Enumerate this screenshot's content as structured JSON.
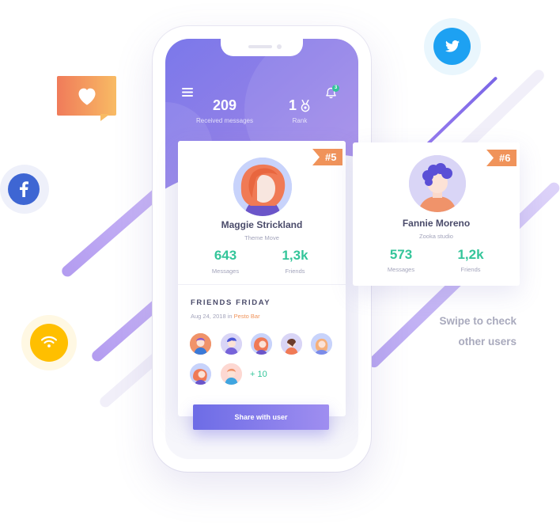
{
  "header": {
    "menu_icon": "hamburger-icon",
    "notification_icon": "bell-icon",
    "notification_count": "3",
    "received_messages_value": "209",
    "received_messages_label": "Received messages",
    "rank_value": "1",
    "rank_label": "Rank",
    "rank_icon": "medal-icon"
  },
  "main_card": {
    "badge": "#5",
    "name": "Maggie Strickland",
    "subtitle": "Theme Move",
    "messages_value": "643",
    "messages_label": "Messages",
    "friends_value": "1,3k",
    "friends_label": "Friends"
  },
  "friends_friday": {
    "title": "FRIENDS FRIDAY",
    "date": "Aug 24, 2018 in ",
    "venue": "Pesto Bar",
    "more_count": "+ 10",
    "share_button": "Share with user"
  },
  "next_card": {
    "badge": "#6",
    "name": "Fannie Moreno",
    "subtitle": "Zooka studio",
    "messages_value": "573",
    "messages_label": "Messages",
    "friends_value": "1,2k",
    "friends_label": "Friends"
  },
  "hint": {
    "line1": "Swipe to check",
    "line2": "other users"
  },
  "social_icons": [
    "heart-icon",
    "facebook-icon",
    "twitter-icon",
    "wifi-icon"
  ],
  "colors": {
    "accent_purple": "#7b78ea",
    "badge_orange": "#f0935a",
    "metric_green": "#34c59a",
    "facebook_blue": "#3e66d3",
    "twitter_blue": "#1da1f2",
    "wifi_yellow": "#ffbf00"
  }
}
